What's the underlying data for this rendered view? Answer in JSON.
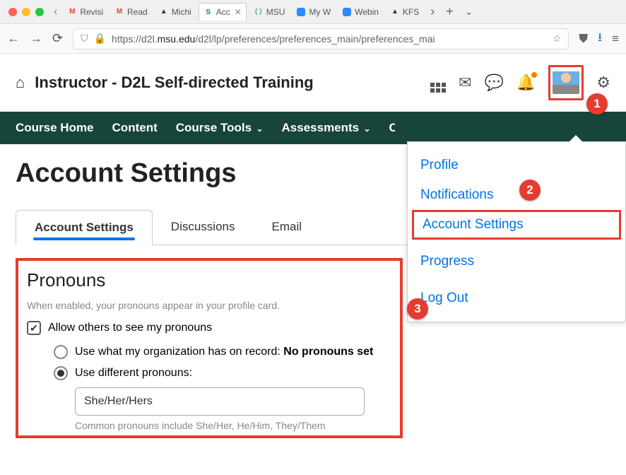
{
  "browser": {
    "tabs": [
      {
        "label": "Revisi"
      },
      {
        "label": "Read "
      },
      {
        "label": "Michi"
      },
      {
        "label": "Acc",
        "active": true
      },
      {
        "label": "MSU "
      },
      {
        "label": "My W"
      },
      {
        "label": "Webin"
      },
      {
        "label": "KFS "
      }
    ],
    "url_prefix": "https://d2l.",
    "url_domain": "msu.edu",
    "url_path": "/d2l/lp/preferences/preferences_main/preferences_mai"
  },
  "header": {
    "course_title": "Instructor - D2L Self-directed Training"
  },
  "nav": {
    "items": [
      "Course Home",
      "Content",
      "Course Tools",
      "Assessments"
    ]
  },
  "page": {
    "title": "Account Settings"
  },
  "tabs": {
    "items": [
      "Account Settings",
      "Discussions",
      "Email"
    ],
    "active": 0
  },
  "pronouns": {
    "title": "Pronouns",
    "desc": "When enabled, your pronouns appear in your profile card.",
    "allow_label": "Allow others to see my pronouns",
    "allow_checked": true,
    "org_label_prefix": "Use what my organization has on record: ",
    "org_value": "No pronouns set",
    "diff_label": "Use different pronouns:",
    "diff_selected": true,
    "input_value": "She/Her/Hers",
    "hint": "Common pronouns include She/Her, He/Him, They/Them"
  },
  "menu": {
    "items": [
      "Profile",
      "Notifications",
      "Account Settings",
      "Progress",
      "Log Out"
    ],
    "highlighted": 2
  },
  "callouts": {
    "c1": "1",
    "c2": "2",
    "c3": "3"
  }
}
